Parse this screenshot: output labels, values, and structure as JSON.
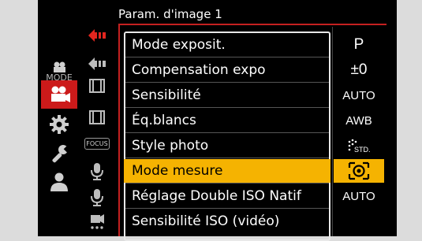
{
  "header": {
    "title": "Param. d'image 1"
  },
  "categories": [
    {
      "name": "mode",
      "label": "MODE"
    },
    {
      "name": "video",
      "active": true
    },
    {
      "name": "custom"
    },
    {
      "name": "setup"
    },
    {
      "name": "my-menu"
    }
  ],
  "submenu_icons": [
    "image-settings-red",
    "image-settings",
    "film-frame",
    "film-frame-2",
    "focus",
    "microphone",
    "microphone-2",
    "network"
  ],
  "submenu_focus_label": "FOCUS",
  "menu_items": [
    {
      "label": "Mode exposit.",
      "value": "P"
    },
    {
      "label": "Compensation expo",
      "value": "±0"
    },
    {
      "label": "Sensibilité",
      "value": "AUTO"
    },
    {
      "label": "Éq.blancs",
      "value": "AWB"
    },
    {
      "label": "Style photo",
      "value": "STD."
    },
    {
      "label": "Mode mesure",
      "value": "metering-icon",
      "selected": true
    },
    {
      "label": "Réglage Double ISO Natif",
      "value": "AUTO"
    },
    {
      "label": "Sensibilité ISO (vidéo)",
      "value": ""
    }
  ],
  "colors": {
    "accent": "#f5b301",
    "active_tab": "#cc1a1a",
    "background": "#000000"
  }
}
